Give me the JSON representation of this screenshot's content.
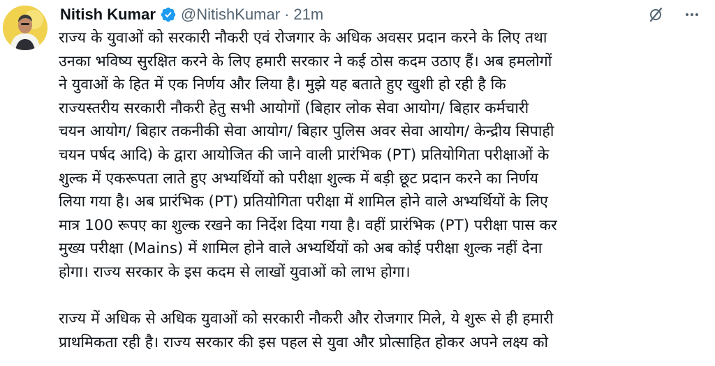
{
  "author": {
    "name": "Nitish Kumar",
    "handle": "@NitishKumar",
    "separator": "·",
    "time": "21m"
  },
  "icons": {
    "verified": "verified-badge-icon",
    "grok": "grok-slash-icon",
    "more": "more-options-icon"
  },
  "colors": {
    "verified_blue": "#1d9bf0",
    "text_primary": "#0f1419",
    "text_secondary": "#536471"
  },
  "tweet": {
    "paragraphs": [
      "राज्य के युवाओं को सरकारी नौकरी एवं रोजगार के अधिक अवसर प्रदान करने के लिए तथा\nउनका भविष्य सुरक्षित करने के लिए हमारी सरकार ने कई ठोस कदम उठाए हैं। अब हमलोगों\nने युवाओं के हित में एक निर्णय और लिया है। मुझे यह बताते हुए खुशी हो रही है कि\nराज्यस्तरीय सरकारी नौकरी हेतु सभी आयोगों (बिहार लोक सेवा आयोग/ बिहार कर्मचारी\nचयन आयोग/ बिहार तकनीकी सेवा आयोग/ बिहार पुलिस अवर सेवा आयोग/ केन्द्रीय सिपाही\nचयन पर्षद आदि) के द्वारा आयोजित की जाने वाली प्रारंभिक (PT) प्रतियोगिता परीक्षाओं के\nशुल्क में एकरूपता लाते हुए अभ्यर्थियों को परीक्षा शुल्क में बड़ी छूट प्रदान करने का निर्णय\nलिया गया है। अब प्रारंभिक (PT) प्रतियोगिता परीक्षा में शामिल होने वाले अभ्यर्थियों के लिए\nमात्र 100 रूपए का शुल्क रखने का निर्देश दिया गया है। वहीं प्रारंभिक (PT) परीक्षा पास कर\nमुख्य परीक्षा (Mains) में शामिल होने वाले अभ्यर्थियों को अब कोई परीक्षा शुल्क नहीं देना\nहोगा। राज्य सरकार के इस कदम से लाखों युवाओं को लाभ होगा।",
      "राज्य में अधिक से अधिक युवाओं को सरकारी नौकरी और रोजगार मिले, ये शुरू से ही हमारी\nप्राथमिकता रही है। राज्य सरकार की इस पहल से युवा और प्रोत्साहित होकर अपने लक्ष्य को"
    ]
  }
}
